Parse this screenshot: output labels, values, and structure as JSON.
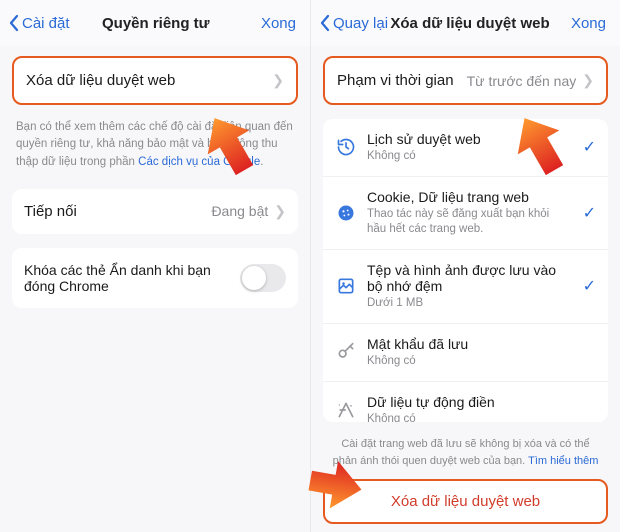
{
  "accent": "#2a6ad6",
  "highlight_border": "#e55a1f",
  "left": {
    "nav": {
      "back": "Cài đặt",
      "title": "Quyền riêng tư",
      "done": "Xong"
    },
    "clear_row": {
      "label": "Xóa dữ liệu duyệt web"
    },
    "help_pre": "Bạn có thể xem thêm các chế độ cài đặt liên quan đến quyền riêng tư, khả năng bảo mật và hoạt động thu thập dữ liệu trong phần ",
    "help_link": "Các dịch vụ của Google",
    "preload": {
      "label": "Tiếp nối",
      "value": "Đang bật"
    },
    "lock": {
      "label": "Khóa các thẻ Ẩn danh khi bạn đóng Chrome"
    }
  },
  "right": {
    "nav": {
      "back": "Quay lại",
      "title": "Xóa dữ liệu duyệt web",
      "done": "Xong"
    },
    "range": {
      "label": "Phạm vi thời gian",
      "value": "Từ trước đến nay"
    },
    "items": [
      {
        "icon": "history",
        "title": "Lịch sử duyệt web",
        "sub": "Không có",
        "checked": true
      },
      {
        "icon": "cookie",
        "title": "Cookie, Dữ liệu trang web",
        "sub": "Thao tác này sẽ đăng xuất bạn khỏi hầu hết các trang web.",
        "checked": true
      },
      {
        "icon": "cache",
        "title": "Tệp và hình ảnh được lưu vào bộ nhớ đệm",
        "sub": "Dưới 1 MB",
        "checked": true
      },
      {
        "icon": "key",
        "title": "Mật khẩu đã lưu",
        "sub": "Không có",
        "checked": false
      },
      {
        "icon": "autofill",
        "title": "Dữ liệu tự động điền",
        "sub": "Không có",
        "checked": false
      }
    ],
    "footer_pre": "Cài đặt trang web đã lưu sẽ không bị xóa và có thể phản ánh thói quen duyệt web của bạn. ",
    "footer_link": "Tìm hiểu thêm",
    "action": "Xóa dữ liệu duyệt web"
  }
}
